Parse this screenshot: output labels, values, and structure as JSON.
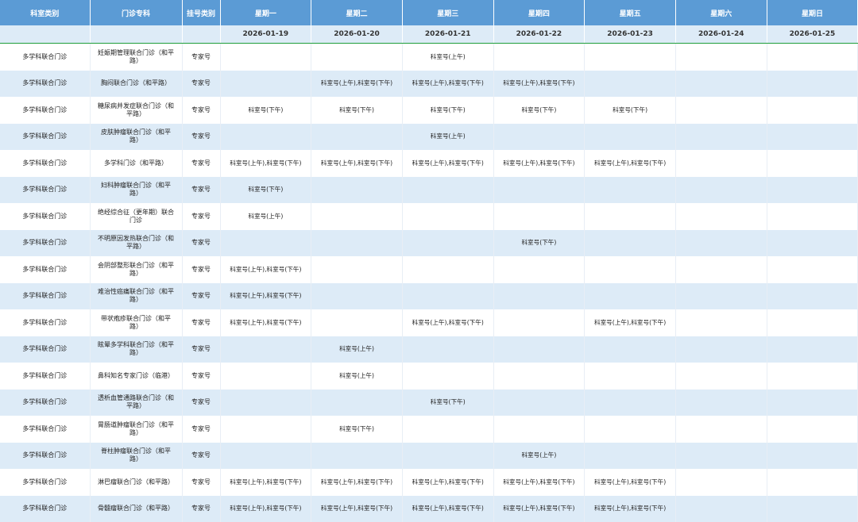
{
  "headers": [
    "科室类别",
    "门诊专科",
    "挂号类别",
    "星期一",
    "星期二",
    "星期三",
    "星期四",
    "星期五",
    "星期六",
    "星期日"
  ],
  "dates": [
    "",
    "",
    "",
    "2026-01-19",
    "2026-01-20",
    "2026-01-21",
    "2026-01-22",
    "2026-01-23",
    "2026-01-24",
    "2026-01-25"
  ],
  "rows": [
    {
      "category": "多学科联合门诊",
      "specialty": "妊娠期管理联合门诊（和平路）",
      "type": "专家号",
      "days": [
        "",
        "",
        "科室号(上午)",
        "",
        "",
        "",
        ""
      ]
    },
    {
      "category": "多学科联合门诊",
      "specialty": "胸闷联合门诊（和平路）",
      "type": "专家号",
      "days": [
        "",
        "科室号(上午),科室号(下午)",
        "科室号(上午),科室号(下午)",
        "科室号(上午),科室号(下午)",
        "",
        "",
        ""
      ]
    },
    {
      "category": "多学科联合门诊",
      "specialty": "糖尿病并发症联合门诊（和平路）",
      "type": "专家号",
      "days": [
        "科室号(下午)",
        "科室号(下午)",
        "科室号(下午)",
        "科室号(下午)",
        "科室号(下午)",
        "",
        ""
      ]
    },
    {
      "category": "多学科联合门诊",
      "specialty": "皮肤肿瘤联合门诊（和平路）",
      "type": "专家号",
      "days": [
        "",
        "",
        "科室号(上午)",
        "",
        "",
        "",
        ""
      ]
    },
    {
      "category": "多学科联合门诊",
      "specialty": "多学科门诊（和平路）",
      "type": "专家号",
      "days": [
        "科室号(上午),科室号(下午)",
        "科室号(上午),科室号(下午)",
        "科室号(上午),科室号(下午)",
        "科室号(上午),科室号(下午)",
        "科室号(上午),科室号(下午)",
        "",
        ""
      ]
    },
    {
      "category": "多学科联合门诊",
      "specialty": "妇科肿瘤联合门诊（和平路）",
      "type": "专家号",
      "days": [
        "科室号(下午)",
        "",
        "",
        "",
        "",
        "",
        ""
      ]
    },
    {
      "category": "多学科联合门诊",
      "specialty": "绝经综合征（更年期）联合门诊",
      "type": "专家号",
      "days": [
        "科室号(上午)",
        "",
        "",
        "",
        "",
        "",
        ""
      ]
    },
    {
      "category": "多学科联合门诊",
      "specialty": "不明原因发热联合门诊（和平路）",
      "type": "专家号",
      "days": [
        "",
        "",
        "",
        "科室号(下午)",
        "",
        "",
        ""
      ]
    },
    {
      "category": "多学科联合门诊",
      "specialty": "会阴部整形联合门诊（和平路）",
      "type": "专家号",
      "days": [
        "科室号(上午),科室号(下午)",
        "",
        "",
        "",
        "",
        "",
        ""
      ]
    },
    {
      "category": "多学科联合门诊",
      "specialty": "难治性癌痛联合门诊（和平路）",
      "type": "专家号",
      "days": [
        "科室号(上午),科室号(下午)",
        "",
        "",
        "",
        "",
        "",
        ""
      ]
    },
    {
      "category": "多学科联合门诊",
      "specialty": "带状疱疹联合门诊（和平路）",
      "type": "专家号",
      "days": [
        "科室号(上午),科室号(下午)",
        "",
        "科室号(上午),科室号(下午)",
        "",
        "科室号(上午),科室号(下午)",
        "",
        ""
      ]
    },
    {
      "category": "多学科联合门诊",
      "specialty": "眩晕多学科联合门诊（和平路）",
      "type": "专家号",
      "days": [
        "",
        "科室号(上午)",
        "",
        "",
        "",
        "",
        ""
      ]
    },
    {
      "category": "多学科联合门诊",
      "specialty": "鼻科知名专家门诊（临港）",
      "type": "专家号",
      "days": [
        "",
        "科室号(上午)",
        "",
        "",
        "",
        "",
        ""
      ]
    },
    {
      "category": "多学科联合门诊",
      "specialty": "透析血管通路联合门诊（和平路）",
      "type": "专家号",
      "days": [
        "",
        "",
        "科室号(下午)",
        "",
        "",
        "",
        ""
      ]
    },
    {
      "category": "多学科联合门诊",
      "specialty": "胃肠道肿瘤联合门诊（和平路）",
      "type": "专家号",
      "days": [
        "",
        "科室号(下午)",
        "",
        "",
        "",
        "",
        ""
      ]
    },
    {
      "category": "多学科联合门诊",
      "specialty": "脊柱肿瘤联合门诊（和平路）",
      "type": "专家号",
      "days": [
        "",
        "",
        "",
        "科室号(上午)",
        "",
        "",
        ""
      ]
    },
    {
      "category": "多学科联合门诊",
      "specialty": "淋巴瘤联合门诊（和平路）",
      "type": "专家号",
      "days": [
        "科室号(上午),科室号(下午)",
        "科室号(上午),科室号(下午)",
        "科室号(上午),科室号(下午)",
        "科室号(上午),科室号(下午)",
        "科室号(上午),科室号(下午)",
        "",
        ""
      ]
    },
    {
      "category": "多学科联合门诊",
      "specialty": "骨髓瘤联合门诊（和平路）",
      "type": "专家号",
      "days": [
        "科室号(上午),科室号(下午)",
        "科室号(上午),科室号(下午)",
        "科室号(上午),科室号(下午)",
        "科室号(上午),科室号(下午)",
        "科室号(上午),科室号(下午)",
        "",
        ""
      ]
    }
  ]
}
